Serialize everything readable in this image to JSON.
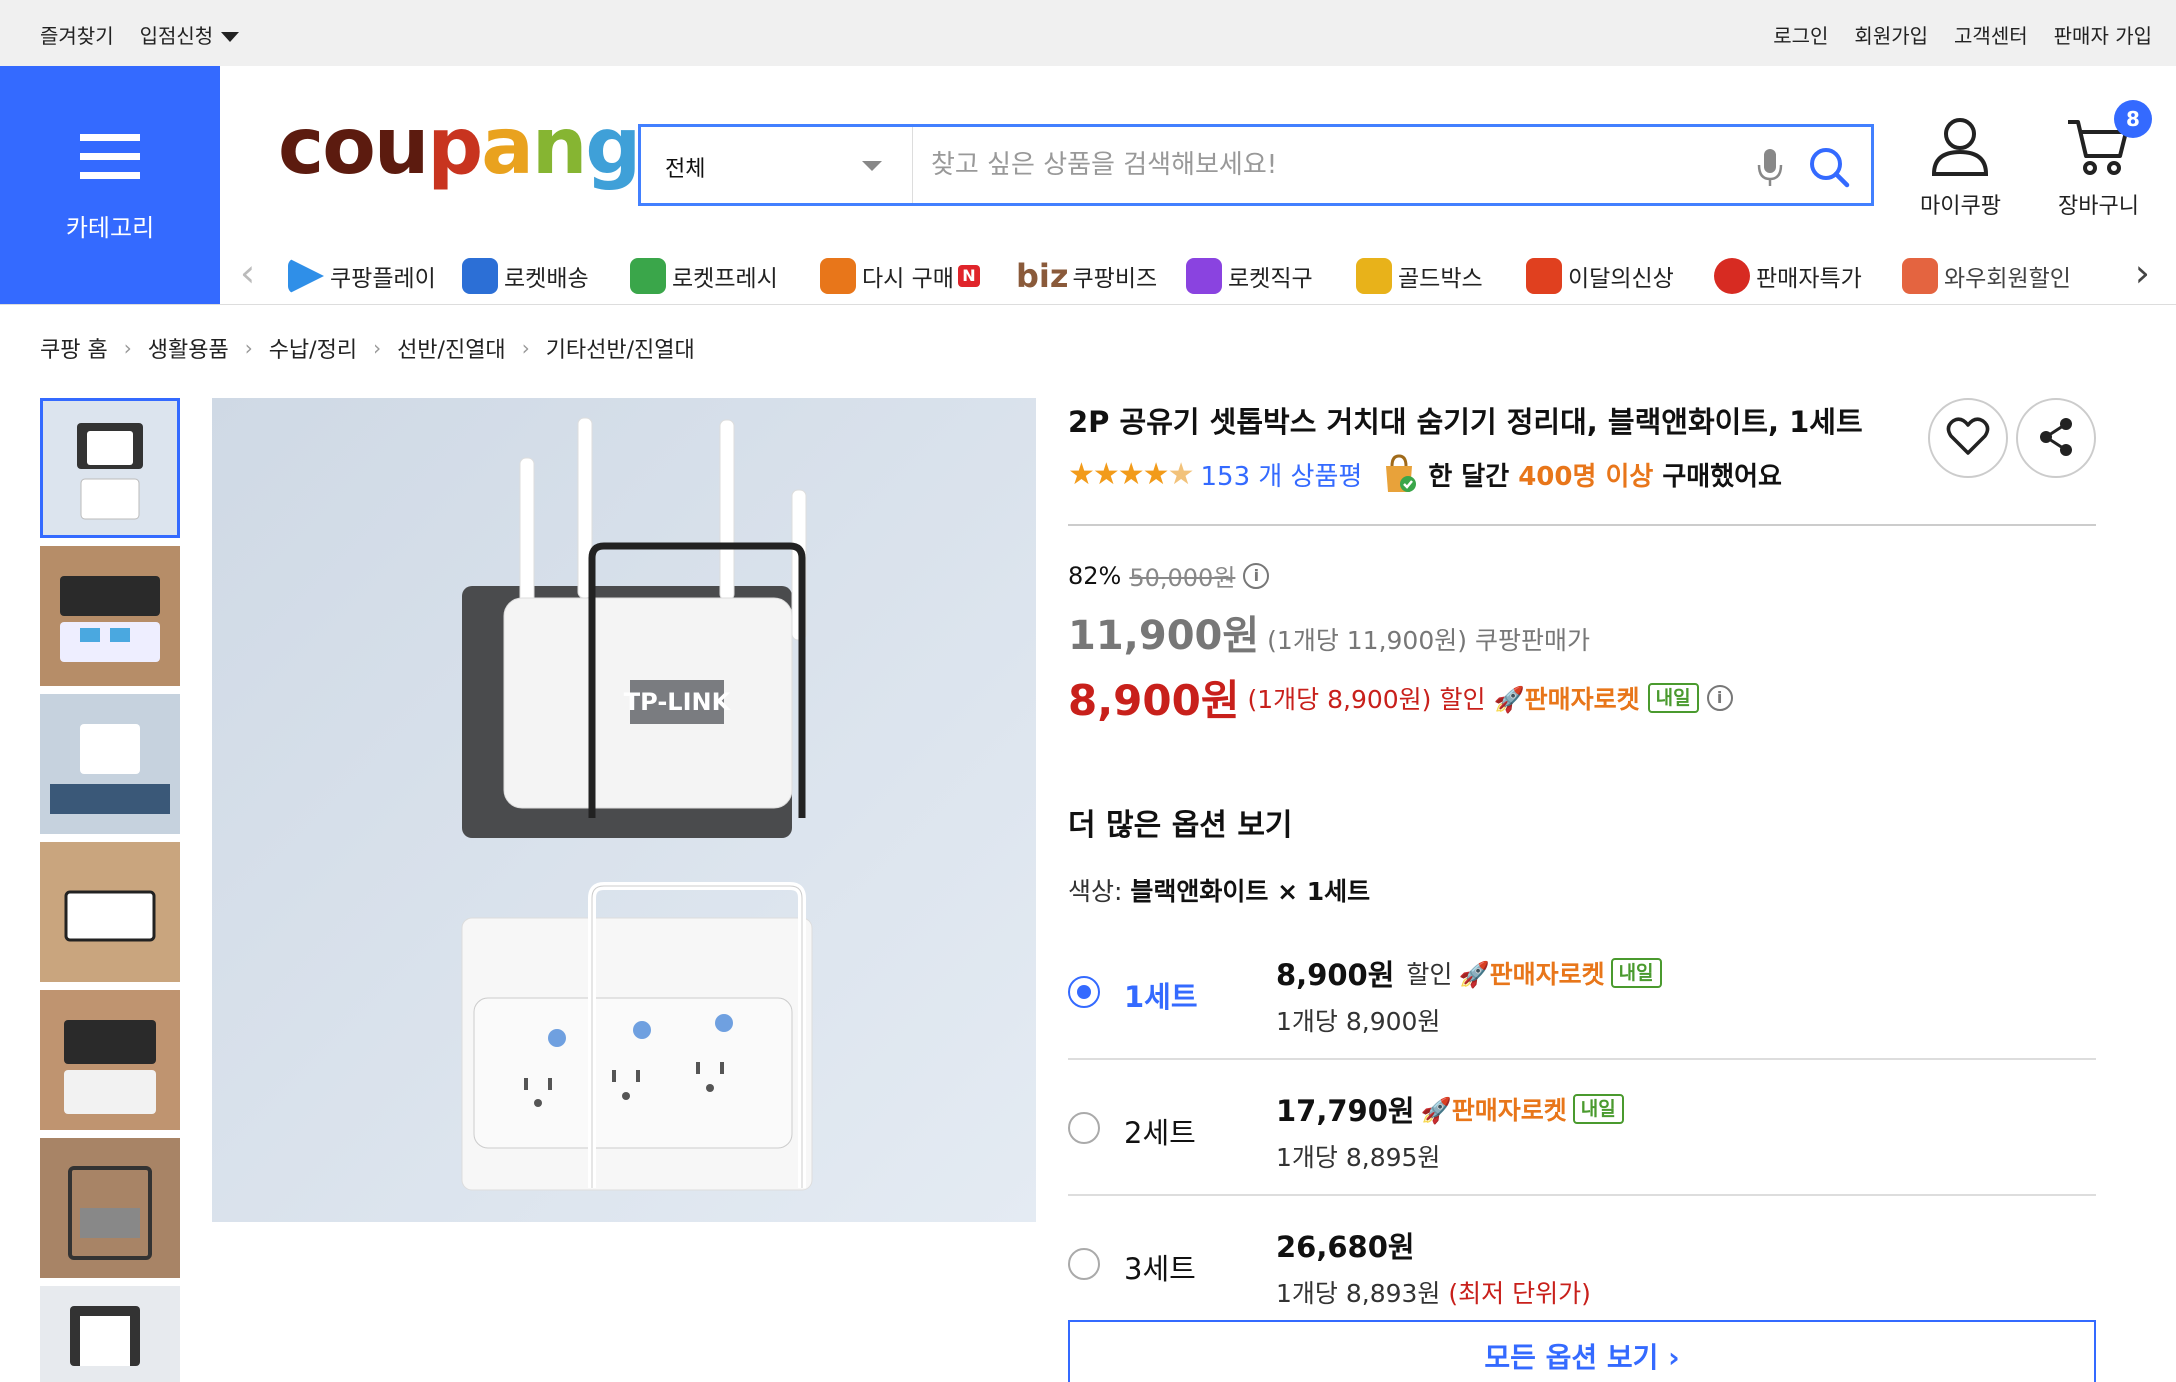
{
  "topbar": {
    "favorites": "즐겨찾기",
    "partner": "입점신청",
    "login": "로그인",
    "signup": "회원가입",
    "support": "고객센터",
    "seller_signup": "판매자 가입"
  },
  "header": {
    "category_label": "카테고리",
    "logo": {
      "c1": "cou",
      "c2": "p",
      "c3": "a",
      "c4": "n",
      "c5": "g"
    },
    "search_select": "전체",
    "search_placeholder": "찾고 싶은 상품을 검색해보세요!",
    "my_coupang": "마이쿠팡",
    "cart": "장바구니",
    "cart_count": "8"
  },
  "catnav": {
    "items": [
      {
        "label": "쿠팡플레이",
        "icon": "play-icon",
        "color": "#2f8fe8"
      },
      {
        "label": "로켓배송",
        "icon": "rocket-icon",
        "color": "#2c6fd6"
      },
      {
        "label": "로켓프레시",
        "icon": "rocket-fresh-icon",
        "color": "#3aa64a"
      },
      {
        "label": "다시 구매",
        "icon": "rebuy-icon",
        "color": "#e8761a",
        "badge": "N"
      },
      {
        "label": "쿠팡비즈",
        "icon": "biz-icon",
        "color": "#8a5a3a",
        "prefix": "biz"
      },
      {
        "label": "로켓직구",
        "icon": "rocket-direct-icon",
        "color": "#8a43e0"
      },
      {
        "label": "골드박스",
        "icon": "goldbox-icon",
        "color": "#e8b21a"
      },
      {
        "label": "이달의신상",
        "icon": "new-icon",
        "color": "#e0401f"
      },
      {
        "label": "판매자특가",
        "icon": "percent-icon",
        "color": "#d72b22"
      },
      {
        "label": "와우회원할인",
        "icon": "wow-icon",
        "color": "#e04a1f",
        "prefix": "wow"
      }
    ]
  },
  "breadcrumb": [
    "쿠팡 홈",
    "생활용품",
    "수납/정리",
    "선반/진열대",
    "기타선반/진열대"
  ],
  "product": {
    "title": "2P 공유기 셋톱박스 거치대 숨기기 정리대, 블랙앤화이트, 1세트",
    "review_count": "153 개 상품평",
    "buy_prefix": "한 달간",
    "buy_highlight": "400명 이상",
    "buy_suffix": "구매했어요",
    "rating": 4.5,
    "discount": "82%",
    "original_price": "50,000원",
    "coupang_price": "11,900원",
    "coupang_unit": "(1개당 11,900원)",
    "coupang_label": "쿠팡판매가",
    "sale_price": "8,900원",
    "sale_unit": "(1개당 8,900원)",
    "sale_label": "할인",
    "rocket_label": "판매자로켓",
    "naeil": "내일",
    "more_options": "더 많은 옵션 보기",
    "color_prefix": "색상:",
    "color_value": "블랙앤화이트 × 1세트",
    "options": [
      {
        "name": "1세트",
        "price": "8,900원",
        "tag": "할인",
        "unit": "1개당 8,900원",
        "rocket": true,
        "selected": true
      },
      {
        "name": "2세트",
        "price": "17,790원",
        "tag": "",
        "unit": "1개당 8,895원",
        "rocket": true,
        "selected": false
      },
      {
        "name": "3세트",
        "price": "26,680원",
        "tag": "",
        "unit": "1개당 8,893원",
        "lowest": "(최저 단위가)",
        "rocket": false,
        "selected": false
      }
    ],
    "all_options": "모든 옵션 보기 ›",
    "image_label": "TP-LINK"
  },
  "colors": {
    "brand_blue": "#346aff",
    "sale_red": "#c8201b",
    "rocket_orange": "#e8761a",
    "naeil_green": "#4a9a2e"
  }
}
